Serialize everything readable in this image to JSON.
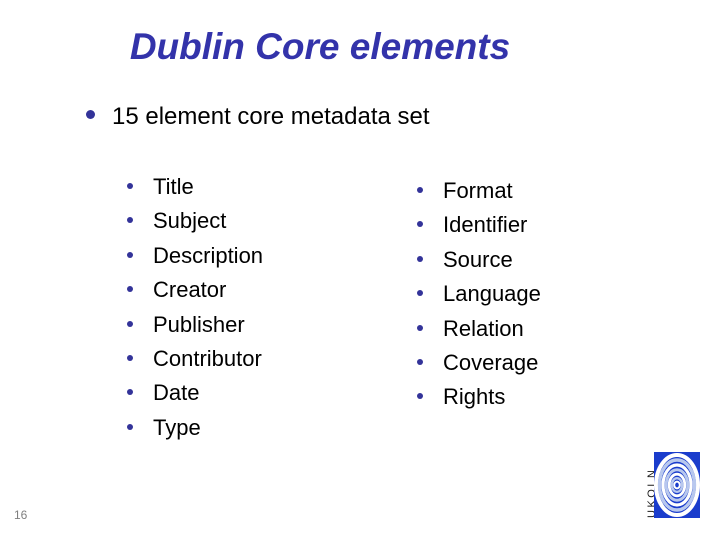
{
  "slide": {
    "title": "Dublin Core elements",
    "page_number": "16",
    "lead": {
      "bullet_icon": "bullet-dot-icon",
      "text": "15 element core metadata set"
    },
    "columns": {
      "left": [
        "Title",
        "Subject",
        "Description",
        "Creator",
        "Publisher",
        "Contributor",
        "Date",
        "Type"
      ],
      "right": [
        "Format",
        "Identifier",
        "Source",
        "Language",
        "Relation",
        "Coverage",
        "Rights"
      ]
    },
    "logo": {
      "wordmark": "UKOLN",
      "mark_icon": "spiral-icon"
    },
    "colors": {
      "title": "#3333aa",
      "bullet": "#333399",
      "body_text": "#000000",
      "page_number": "#7f7f7f",
      "logo_background": "#1a3ccc",
      "logo_spiral_light": "#b8c8ee",
      "logo_spiral_white": "#ffffff"
    }
  }
}
